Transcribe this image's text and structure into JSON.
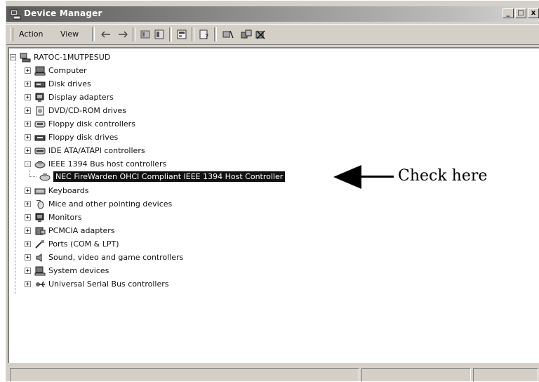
{
  "window": {
    "title": "Device Manager",
    "buttons": {
      "minimize": "_",
      "maximize": "□",
      "close": "x"
    }
  },
  "toolbar": {
    "menus": [
      "Action",
      "View"
    ],
    "icons": [
      "back-arrow-icon",
      "forward-arrow-icon",
      "up-folder-icon",
      "show-hide-tree-icon",
      "properties-icon",
      "help-icon",
      "scan-hardware-icon",
      "update-driver-icon",
      "uninstall-icon"
    ]
  },
  "tree": {
    "root": "RATOC-1MUTPESUD",
    "items": [
      {
        "label": "Computer",
        "icon": "computer-icon",
        "expander": "+"
      },
      {
        "label": "Disk drives",
        "icon": "disk-drive-icon",
        "expander": "+"
      },
      {
        "label": "Display adapters",
        "icon": "display-adapter-icon",
        "expander": "+"
      },
      {
        "label": "DVD/CD-ROM drives",
        "icon": "cdrom-icon",
        "expander": "+"
      },
      {
        "label": "Floppy disk controllers",
        "icon": "floppy-controller-icon",
        "expander": "+"
      },
      {
        "label": "Floppy disk drives",
        "icon": "floppy-drive-icon",
        "expander": "+"
      },
      {
        "label": "IDE ATA/ATAPI controllers",
        "icon": "ide-controller-icon",
        "expander": "+"
      },
      {
        "label": "IEEE 1394 Bus host controllers",
        "icon": "ieee1394-icon",
        "expander": "-"
      },
      {
        "label": "Keyboards",
        "icon": "keyboard-icon",
        "expander": "+"
      },
      {
        "label": "Mice and other pointing devices",
        "icon": "mouse-icon",
        "expander": "+"
      },
      {
        "label": "Monitors",
        "icon": "monitor-icon",
        "expander": "+"
      },
      {
        "label": "PCMCIA adapters",
        "icon": "pcmcia-icon",
        "expander": "+"
      },
      {
        "label": "Ports (COM & LPT)",
        "icon": "port-icon",
        "expander": "+"
      },
      {
        "label": "Sound, video and game controllers",
        "icon": "sound-icon",
        "expander": "+"
      },
      {
        "label": "System devices",
        "icon": "system-device-icon",
        "expander": "+"
      },
      {
        "label": "Universal Serial Bus controllers",
        "icon": "usb-icon",
        "expander": "+"
      }
    ],
    "child": {
      "label": "NEC FireWarden OHCI Compliant IEEE 1394 Host Controller",
      "icon": "ieee1394-device-icon"
    }
  },
  "annotation": {
    "text": "Check here"
  },
  "colors": {
    "titlebar_start": "#5a5a5a",
    "selection": "#111111",
    "face": "#d4d0c8"
  }
}
